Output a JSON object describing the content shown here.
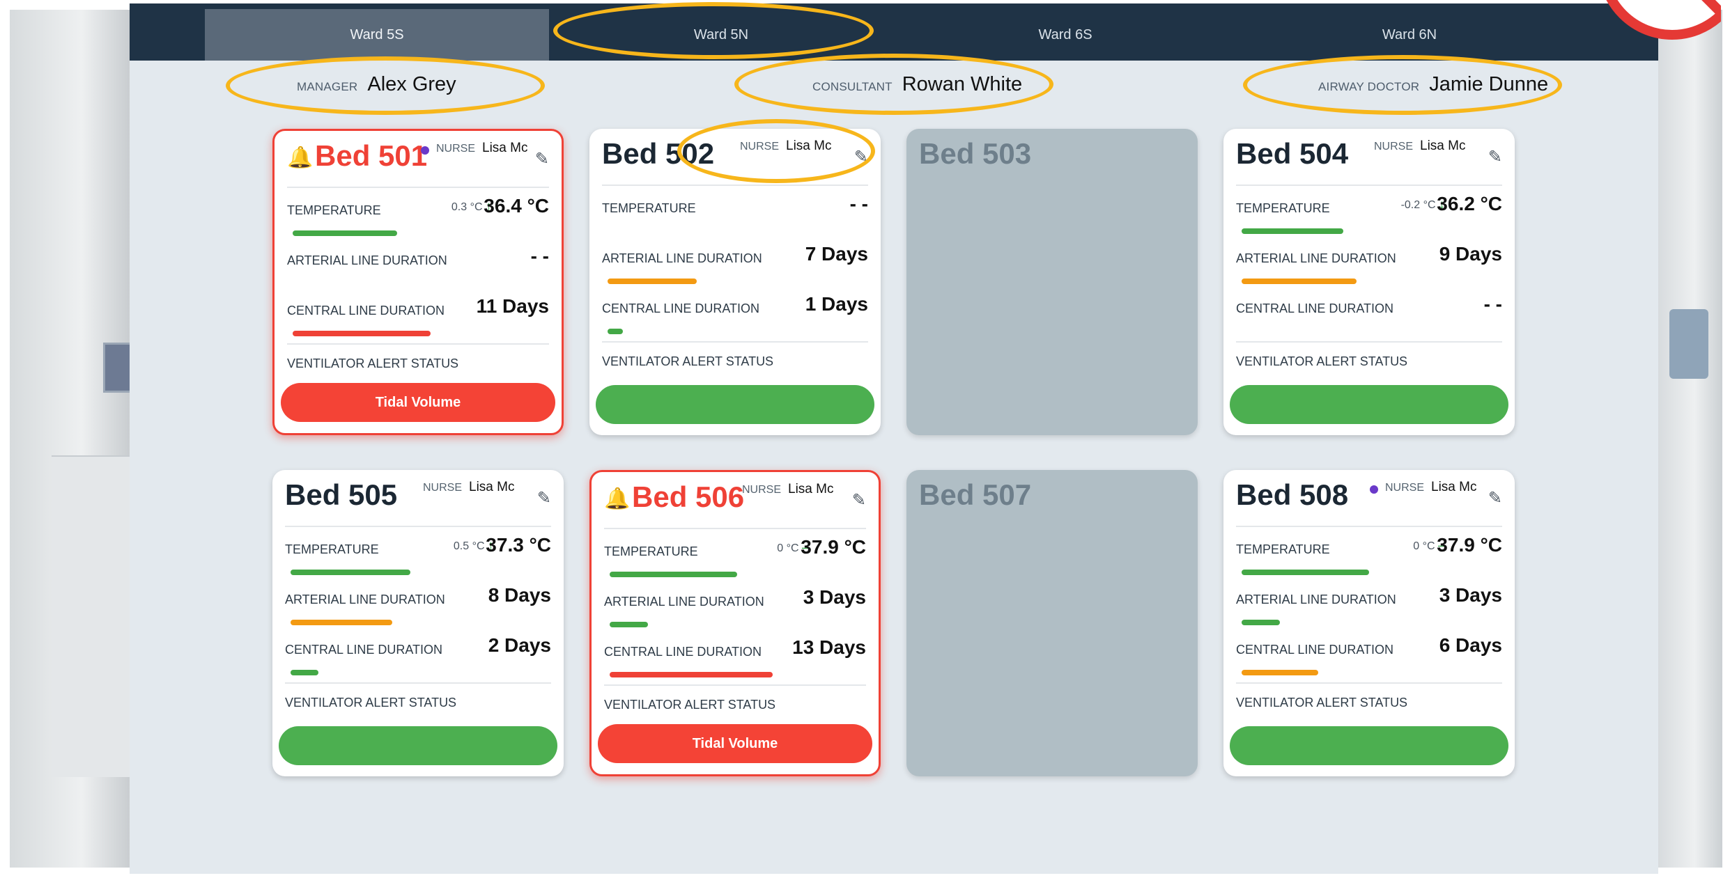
{
  "tabs": [
    {
      "label": "Ward 5S",
      "active": true
    },
    {
      "label": "Ward 5N",
      "active": false
    },
    {
      "label": "Ward 6S",
      "active": false
    },
    {
      "label": "Ward 6N",
      "active": false
    }
  ],
  "staff": {
    "manager": {
      "role": "MANAGER",
      "name": "Alex Grey"
    },
    "consultant": {
      "role": "CONSULTANT",
      "name": "Rowan White"
    },
    "airway": {
      "role": "AIRWAY DOCTOR",
      "name": "Jamie Dunne"
    }
  },
  "labels": {
    "nurse": "NURSE",
    "temperature": "TEMPERATURE",
    "arterial": "ARTERIAL LINE DURATION",
    "central": "CENTRAL LINE DURATION",
    "ventilator": "VENTILATOR ALERT STATUS"
  },
  "beds": [
    {
      "name": "Bed 501",
      "alert": true,
      "nurse": "Lisa Mc",
      "dot": true,
      "temp_delta": "0.3 °C",
      "temp_trend": "up",
      "temp": "36.4 °C",
      "temp_fill": 0.41,
      "temp_color": "green",
      "arterial": "- -",
      "arterial_fill": 0,
      "arterial_color": "orange",
      "central": "11 Days",
      "central_fill": 0.54,
      "central_color": "red",
      "vent": "Tidal Volume",
      "vent_status": "bad"
    },
    {
      "name": "Bed 502",
      "alert": false,
      "nurse": "Lisa Mc",
      "dot": false,
      "temp_delta": "",
      "temp_trend": "",
      "temp": "- -",
      "temp_fill": 0,
      "temp_color": "green",
      "arterial": "7 Days",
      "arterial_fill": 0.35,
      "arterial_color": "orange",
      "central": "1 Days",
      "central_fill": 0.06,
      "central_color": "green",
      "vent": "",
      "vent_status": "ok"
    },
    {
      "name": "Bed 503",
      "empty": true
    },
    {
      "name": "Bed 504",
      "alert": false,
      "nurse": "Lisa Mc",
      "dot": false,
      "temp_delta": "-0.2 °C",
      "temp_trend": "down",
      "temp": "36.2 °C",
      "temp_fill": 0.4,
      "temp_color": "green",
      "arterial": "9 Days",
      "arterial_fill": 0.45,
      "arterial_color": "orange",
      "central": "- -",
      "central_fill": 0,
      "central_color": "green",
      "vent": "",
      "vent_status": "ok"
    },
    {
      "name": "Bed 505",
      "alert": false,
      "nurse": "Lisa Mc",
      "dot": false,
      "temp_delta": "0.5 °C",
      "temp_trend": "up",
      "temp": "37.3 °C",
      "temp_fill": 0.47,
      "temp_color": "green",
      "arterial": "8 Days",
      "arterial_fill": 0.4,
      "arterial_color": "orange",
      "central": "2 Days",
      "central_fill": 0.11,
      "central_color": "green",
      "vent": "",
      "vent_status": "ok"
    },
    {
      "name": "Bed 506",
      "alert": true,
      "nurse": "Lisa Mc",
      "dot": false,
      "temp_delta": "0 °C",
      "temp_trend": "flat",
      "temp": "37.9 °C",
      "temp_fill": 0.5,
      "temp_color": "green",
      "arterial": "3 Days",
      "arterial_fill": 0.15,
      "arterial_color": "green",
      "central": "13 Days",
      "central_fill": 0.64,
      "central_color": "red",
      "vent": "Tidal Volume",
      "vent_status": "bad"
    },
    {
      "name": "Bed 507",
      "empty": true
    },
    {
      "name": "Bed 508",
      "alert": false,
      "nurse": "Lisa Mc",
      "dot": true,
      "temp_delta": "0 °C",
      "temp_trend": "flat",
      "temp": "37.9 °C",
      "temp_fill": 0.5,
      "temp_color": "green",
      "arterial": "3 Days",
      "arterial_fill": 0.15,
      "arterial_color": "green",
      "central": "6 Days",
      "central_fill": 0.3,
      "central_color": "orange",
      "vent": "",
      "vent_status": "ok"
    }
  ],
  "colors": {
    "alert": "#ef4136",
    "ok": "#4caf50",
    "warn": "#f39a12",
    "nav": "#1f3346",
    "annotation": "#f7b61b"
  }
}
